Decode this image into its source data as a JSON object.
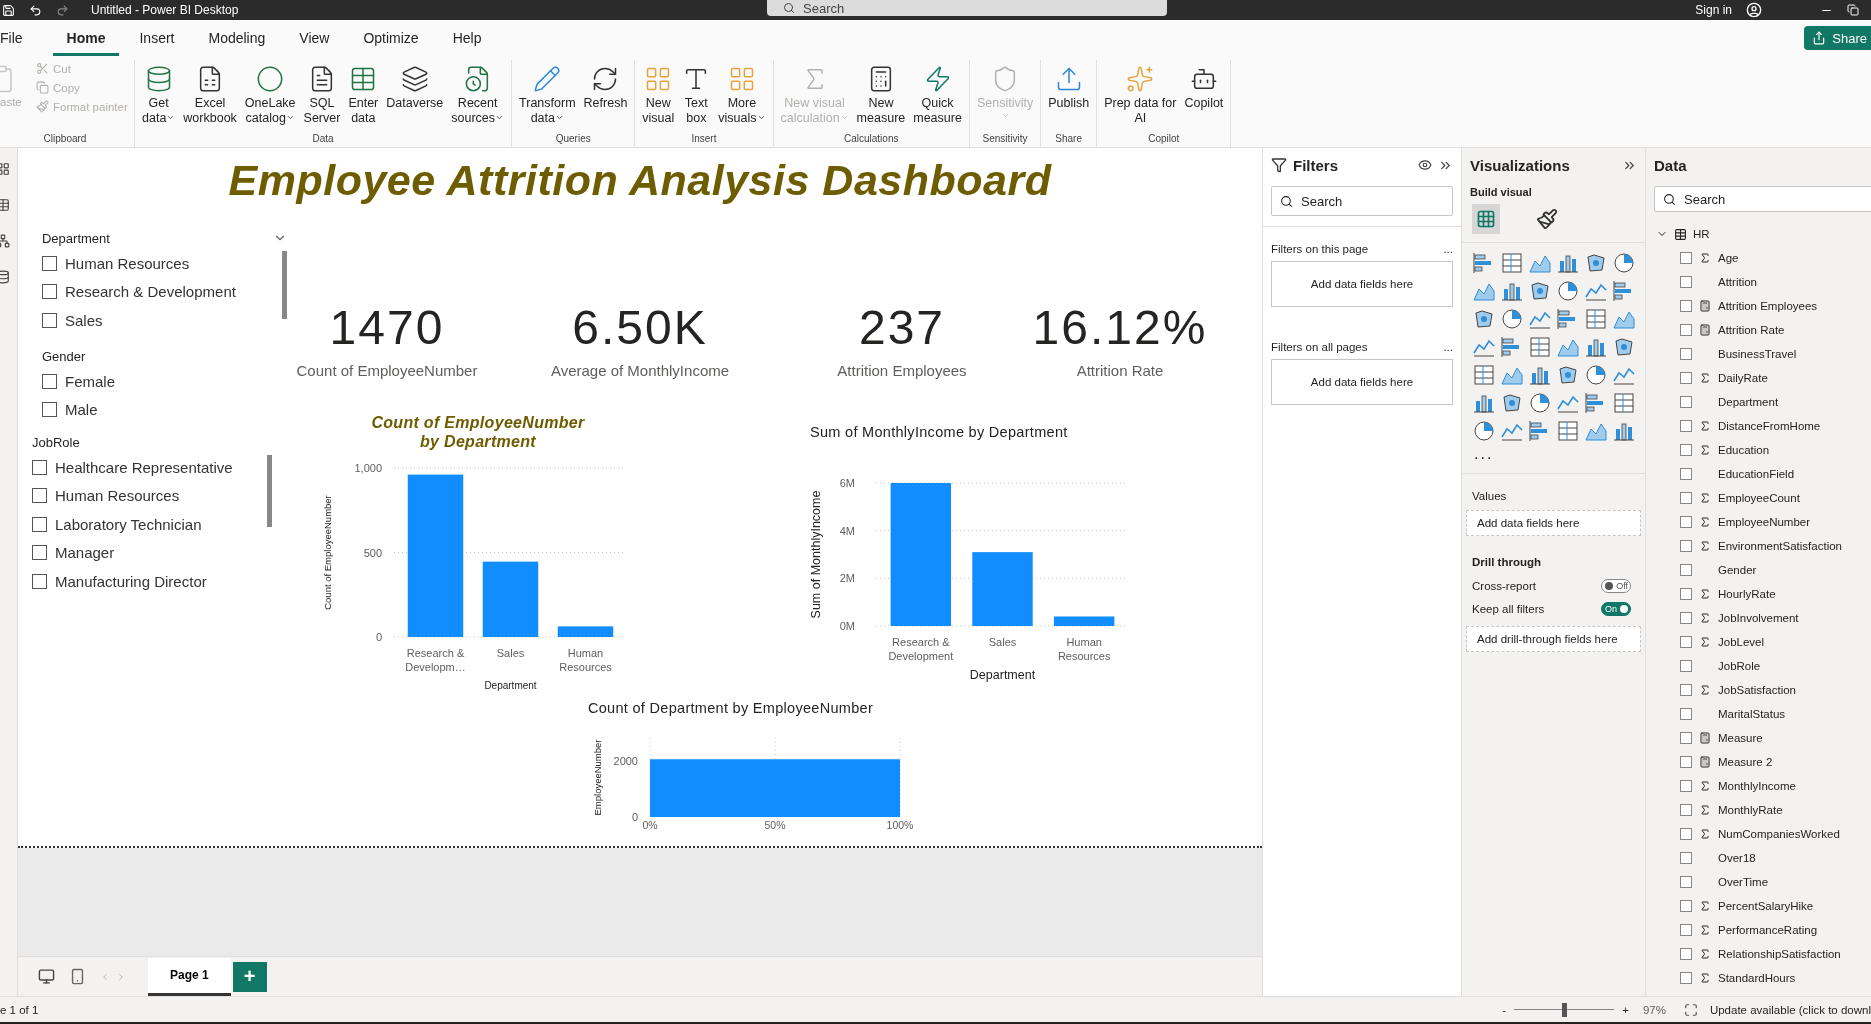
{
  "window": {
    "title": "Untitled - Power BI Desktop",
    "search_placeholder": "Search",
    "sign_in": "Sign in"
  },
  "menu_tabs": [
    {
      "label": "File",
      "selected": false
    },
    {
      "label": "Home",
      "selected": true
    },
    {
      "label": "Insert",
      "selected": false
    },
    {
      "label": "Modeling",
      "selected": false
    },
    {
      "label": "View",
      "selected": false
    },
    {
      "label": "Optimize",
      "selected": false
    },
    {
      "label": "Help",
      "selected": false
    }
  ],
  "share_button": "Share",
  "ribbon": {
    "clipboard": {
      "title": "Clipboard",
      "paste": "aste",
      "paste_disabled": true,
      "items": [
        {
          "label": "Cut",
          "disabled": true
        },
        {
          "label": "Copy",
          "disabled": true
        },
        {
          "label": "Format painter",
          "disabled": true
        }
      ]
    },
    "groups": [
      {
        "title": "Data",
        "buttons": [
          {
            "lines": [
              "Get",
              "data"
            ],
            "dropdown": true,
            "disabled": false
          },
          {
            "lines": [
              "Excel",
              "workbook"
            ],
            "dropdown": false,
            "disabled": false
          },
          {
            "lines": [
              "OneLake",
              "catalog"
            ],
            "dropdown": true,
            "disabled": false
          },
          {
            "lines": [
              "SQL",
              "Server"
            ],
            "dropdown": false,
            "disabled": false
          },
          {
            "lines": [
              "Enter",
              "data"
            ],
            "dropdown": false,
            "disabled": false
          },
          {
            "lines": [
              "Dataverse"
            ],
            "dropdown": false,
            "disabled": false
          },
          {
            "lines": [
              "Recent",
              "sources"
            ],
            "dropdown": true,
            "disabled": false
          }
        ]
      },
      {
        "title": "Queries",
        "buttons": [
          {
            "lines": [
              "Transform",
              "data"
            ],
            "dropdown": true,
            "disabled": false
          },
          {
            "lines": [
              "Refresh"
            ],
            "dropdown": false,
            "disabled": false
          }
        ]
      },
      {
        "title": "Insert",
        "buttons": [
          {
            "lines": [
              "New",
              "visual"
            ],
            "dropdown": false,
            "disabled": false
          },
          {
            "lines": [
              "Text",
              "box"
            ],
            "dropdown": false,
            "disabled": false
          },
          {
            "lines": [
              "More",
              "visuals"
            ],
            "dropdown": true,
            "disabled": false
          }
        ]
      },
      {
        "title": "Calculations",
        "buttons": [
          {
            "lines": [
              "New visual",
              "calculation"
            ],
            "dropdown": true,
            "disabled": true
          },
          {
            "lines": [
              "New",
              "measure"
            ],
            "dropdown": false,
            "disabled": false
          },
          {
            "lines": [
              "Quick",
              "measure"
            ],
            "dropdown": false,
            "disabled": false
          }
        ]
      },
      {
        "title": "Sensitivity",
        "buttons": [
          {
            "lines": [
              "Sensitivity"
            ],
            "dropdown": true,
            "disabled": true
          }
        ]
      },
      {
        "title": "Share",
        "buttons": [
          {
            "lines": [
              "Publish"
            ],
            "dropdown": false,
            "disabled": false
          }
        ]
      },
      {
        "title": "Copilot",
        "buttons": [
          {
            "lines": [
              "Prep data for",
              "AI"
            ],
            "dropdown": false,
            "disabled": false
          },
          {
            "lines": [
              "Copilot"
            ],
            "dropdown": false,
            "disabled": false
          }
        ]
      }
    ]
  },
  "report": {
    "title": "Employee Attrition Analysis Dashboard",
    "slicers": [
      {
        "title": "Department",
        "dropdown": true,
        "items": [
          {
            "label": "Human Resources",
            "checked": false
          },
          {
            "label": "Research & Development",
            "checked": false
          },
          {
            "label": "Sales",
            "checked": false
          }
        ]
      },
      {
        "title": "Gender",
        "dropdown": false,
        "items": [
          {
            "label": "Female",
            "checked": false
          },
          {
            "label": "Male",
            "checked": false
          }
        ]
      },
      {
        "title": "JobRole",
        "dropdown": false,
        "items": [
          {
            "label": "Healthcare Representative",
            "checked": false
          },
          {
            "label": "Human Resources",
            "checked": false
          },
          {
            "label": "Laboratory Technician",
            "checked": false
          },
          {
            "label": "Manager",
            "checked": false
          },
          {
            "label": "Manufacturing Director",
            "checked": false
          }
        ]
      }
    ],
    "kpis": [
      {
        "value": "1470",
        "label": "Count of EmployeeNumber"
      },
      {
        "value": "6.50K",
        "label": "Average of MonthlyIncome"
      },
      {
        "value": "237",
        "label": "Attrition Employees"
      },
      {
        "value": "16.12%",
        "label": "Attrition Rate"
      }
    ],
    "charts": [
      {
        "emphasis": true,
        "chart_data": {
          "type": "bar",
          "title": "Count of EmployeeNumber by Department",
          "xlabel": "Department",
          "ylabel": "Count of EmployeeNumber",
          "categories": [
            "Research & Developm…",
            "Sales",
            "Human Resources"
          ],
          "values": [
            961,
            446,
            63
          ],
          "grid": true,
          "ylim": [
            0,
            1000
          ],
          "yticks": [
            0,
            500,
            {
              "value": 1000,
              "label": "1,000"
            }
          ]
        }
      },
      {
        "emphasis": false,
        "chart_data": {
          "type": "bar",
          "title": "Sum of MonthlyIncome by Department",
          "xlabel": "Department",
          "ylabel": "Sum of MonthlyIncome",
          "categories": [
            "Research & Development",
            "Sales",
            "Human Resources"
          ],
          "values": [
            6000000,
            3100000,
            400000
          ],
          "grid": true,
          "ylim": [
            0,
            6000000
          ],
          "yticks": [
            {
              "value": 0,
              "label": "0M"
            },
            {
              "value": 2000000,
              "label": "2M"
            },
            {
              "value": 4000000,
              "label": "4M"
            },
            {
              "value": 6000000,
              "label": "6M"
            }
          ]
        }
      },
      {
        "emphasis": false,
        "chart_data": {
          "type": "area",
          "title": "Count of Department by EmployeeNumber",
          "ylabel": "EmployeeNumber",
          "x": [
            0,
            100
          ],
          "values": [
            2050,
            2050
          ],
          "grid": true,
          "xlim": [
            0,
            100
          ],
          "ylim": [
            0,
            2800
          ],
          "xticks": [
            {
              "value": 0,
              "label": "0%"
            },
            {
              "value": 50,
              "label": "50%"
            },
            {
              "value": 100,
              "label": "100%"
            }
          ],
          "yticks": [
            0,
            2000
          ]
        }
      }
    ]
  },
  "pages": [
    {
      "label": "Page 1",
      "selected": true
    }
  ],
  "add_page": "+",
  "filters": {
    "title": "Filters",
    "search_placeholder": "Search",
    "sections": [
      {
        "title": "Filters on this page",
        "more": "...",
        "drop": "Add data fields here"
      },
      {
        "title": "Filters on all pages",
        "more": "...",
        "drop": "Add data fields here"
      }
    ]
  },
  "visualizations": {
    "title": "Visualizations",
    "subtitle": "Build visual",
    "more": "...",
    "values_title": "Values",
    "values_drop": "Add data fields here",
    "drill_through": {
      "title": "Drill through",
      "toggles": [
        {
          "label": "Cross-report",
          "on": false,
          "state_label": "Off"
        },
        {
          "label": "Keep all filters",
          "on": true,
          "state_label": "On"
        }
      ],
      "drop": "Add drill-through fields here"
    }
  },
  "data": {
    "title": "Data",
    "search_placeholder": "Search",
    "table": {
      "name": "HR",
      "expanded": true,
      "fields": [
        {
          "name": "Age",
          "kind": "numeric",
          "checked": false
        },
        {
          "name": "Attrition",
          "kind": "text",
          "checked": false
        },
        {
          "name": "Attrition Employees",
          "kind": "measure",
          "checked": false
        },
        {
          "name": "Attrition Rate",
          "kind": "measure",
          "checked": false
        },
        {
          "name": "BusinessTravel",
          "kind": "text",
          "checked": false
        },
        {
          "name": "DailyRate",
          "kind": "numeric",
          "checked": false
        },
        {
          "name": "Department",
          "kind": "text",
          "checked": false
        },
        {
          "name": "DistanceFromHome",
          "kind": "numeric",
          "checked": false
        },
        {
          "name": "Education",
          "kind": "numeric",
          "checked": false
        },
        {
          "name": "EducationField",
          "kind": "text",
          "checked": false
        },
        {
          "name": "EmployeeCount",
          "kind": "numeric",
          "checked": false
        },
        {
          "name": "EmployeeNumber",
          "kind": "numeric",
          "checked": false
        },
        {
          "name": "EnvironmentSatisfaction",
          "kind": "numeric",
          "checked": false
        },
        {
          "name": "Gender",
          "kind": "text",
          "checked": false
        },
        {
          "name": "HourlyRate",
          "kind": "numeric",
          "checked": false
        },
        {
          "name": "JobInvolvement",
          "kind": "numeric",
          "checked": false
        },
        {
          "name": "JobLevel",
          "kind": "numeric",
          "checked": false
        },
        {
          "name": "JobRole",
          "kind": "text",
          "checked": false
        },
        {
          "name": "JobSatisfaction",
          "kind": "numeric",
          "checked": false
        },
        {
          "name": "MaritalStatus",
          "kind": "text",
          "checked": false
        },
        {
          "name": "Measure",
          "kind": "measure",
          "checked": false
        },
        {
          "name": "Measure 2",
          "kind": "measure",
          "checked": false
        },
        {
          "name": "MonthlyIncome",
          "kind": "numeric",
          "checked": false
        },
        {
          "name": "MonthlyRate",
          "kind": "numeric",
          "checked": false
        },
        {
          "name": "NumCompaniesWorked",
          "kind": "numeric",
          "checked": false
        },
        {
          "name": "Over18",
          "kind": "text",
          "checked": false
        },
        {
          "name": "OverTime",
          "kind": "text",
          "checked": false
        },
        {
          "name": "PercentSalaryHike",
          "kind": "numeric",
          "checked": false
        },
        {
          "name": "PerformanceRating",
          "kind": "numeric",
          "checked": false
        },
        {
          "name": "RelationshipSatisfaction",
          "kind": "numeric",
          "checked": false
        },
        {
          "name": "StandardHours",
          "kind": "numeric",
          "checked": false
        }
      ]
    }
  },
  "status_bar": {
    "page_info": "e 1 of 1",
    "zoom_out": "-",
    "zoom_in": "+",
    "zoom": {
      "level": 0.5
    },
    "zoom_reading": "97%",
    "update": "Update available (click to downl"
  }
}
